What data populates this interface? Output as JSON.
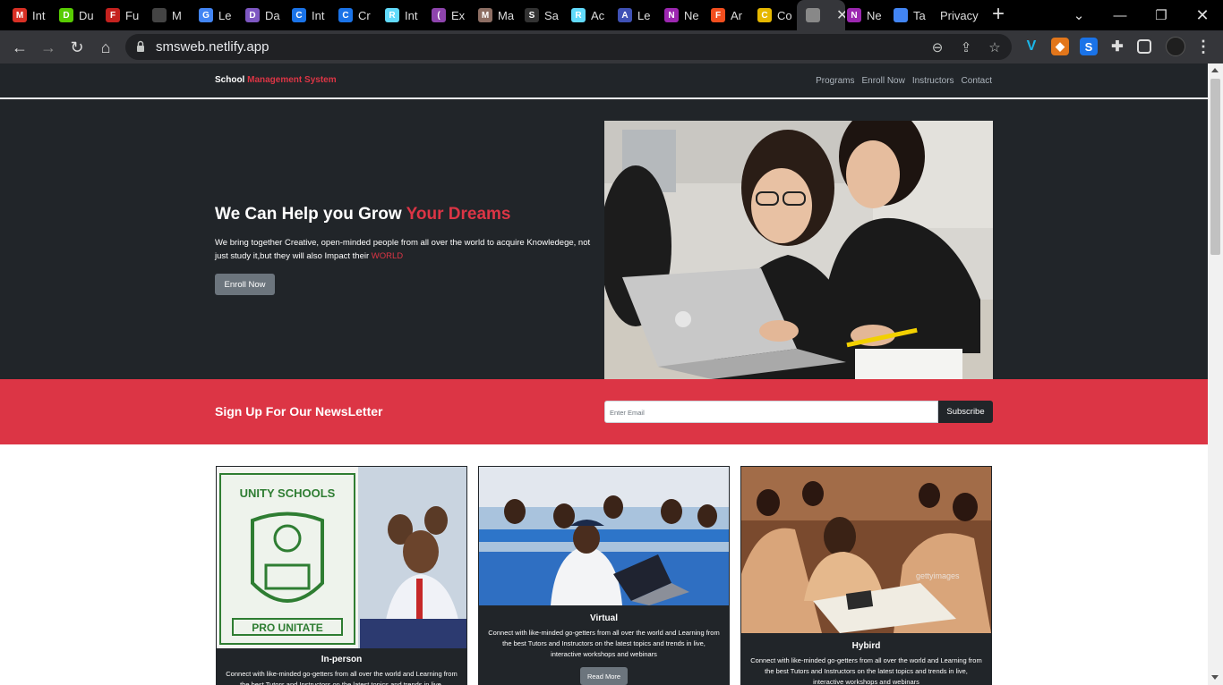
{
  "browser": {
    "tabs": [
      {
        "label": "Int",
        "color": "#d93025",
        "glyph": "M"
      },
      {
        "label": "Du",
        "color": "#58cc02",
        "glyph": "D"
      },
      {
        "label": "Fu",
        "color": "#c5221f",
        "glyph": "F"
      },
      {
        "label": "M",
        "color": "#444444",
        "glyph": ""
      },
      {
        "label": "Le",
        "color": "#4285f4",
        "glyph": "G"
      },
      {
        "label": "Da",
        "color": "#7e57c2",
        "glyph": "D"
      },
      {
        "label": "Int",
        "color": "#1a73e8",
        "glyph": "C"
      },
      {
        "label": "Cr",
        "color": "#1a73e8",
        "glyph": "C"
      },
      {
        "label": "Int",
        "color": "#61dafb",
        "glyph": "R"
      },
      {
        "label": "Ex",
        "color": "#8e44ad",
        "glyph": "("
      },
      {
        "label": "Ma",
        "color": "#8d6e63",
        "glyph": "M"
      },
      {
        "label": "Sa",
        "color": "#333333",
        "glyph": "S"
      },
      {
        "label": "Ac",
        "color": "#61dafb",
        "glyph": "R"
      },
      {
        "label": "Le",
        "color": "#3f51b5",
        "glyph": "A"
      },
      {
        "label": "Ne",
        "color": "#9c27b0",
        "glyph": "N"
      },
      {
        "label": "Ar",
        "color": "#f24e1e",
        "glyph": "F"
      },
      {
        "label": "Co",
        "color": "#e6b800",
        "glyph": "C"
      },
      {
        "label": "",
        "color": "#888888",
        "glyph": ""
      },
      {
        "label": "Ne",
        "color": "#9c27b0",
        "glyph": "N"
      },
      {
        "label": "Ta",
        "color": "#4285f4",
        "glyph": ""
      },
      {
        "label": "Privacy",
        "color": "",
        "glyph": ""
      }
    ],
    "url": "smsweb.netlify.app"
  },
  "site": {
    "brand_white": "School",
    "brand_red": "Management System",
    "nav": [
      "Programs",
      "Enroll Now",
      "Instructors",
      "Contact"
    ],
    "hero": {
      "title_white": "We Can Help you Grow",
      "title_red": "Your Dreams",
      "text": "We bring together Creative, open-minded people from all over the world to acquire Knowledege, not just study it,but they will also Impact their",
      "text_red": "WORLD",
      "button": "Enroll Now"
    },
    "newsletter": {
      "heading": "Sign Up For Our NewsLetter",
      "placeholder": "Enter Email",
      "button": "Subscribe"
    },
    "cards": [
      {
        "title": "In-person",
        "text": "Connect with like-minded go-getters from all over the world and Learning from the best Tutors and Instructors on the latest topics and trends in live, interactive workshops and webinars",
        "badge_text": "UNITY SCHOOLS",
        "motto": "PRO UNITATE"
      },
      {
        "title": "Virtual",
        "text": "Connect with like-minded go-getters from all over the world and Learning from the best Tutors and Instructors on the latest topics and trends in live, interactive workshops and webinars",
        "button": "Read More"
      },
      {
        "title": "Hybird",
        "text": "Connect with like-minded go-getters from all over the world and Learning from the best Tutors and Instructors on the latest topics and trends in live, interactive workshops and webinars",
        "watermark": "gettyimages"
      }
    ]
  }
}
